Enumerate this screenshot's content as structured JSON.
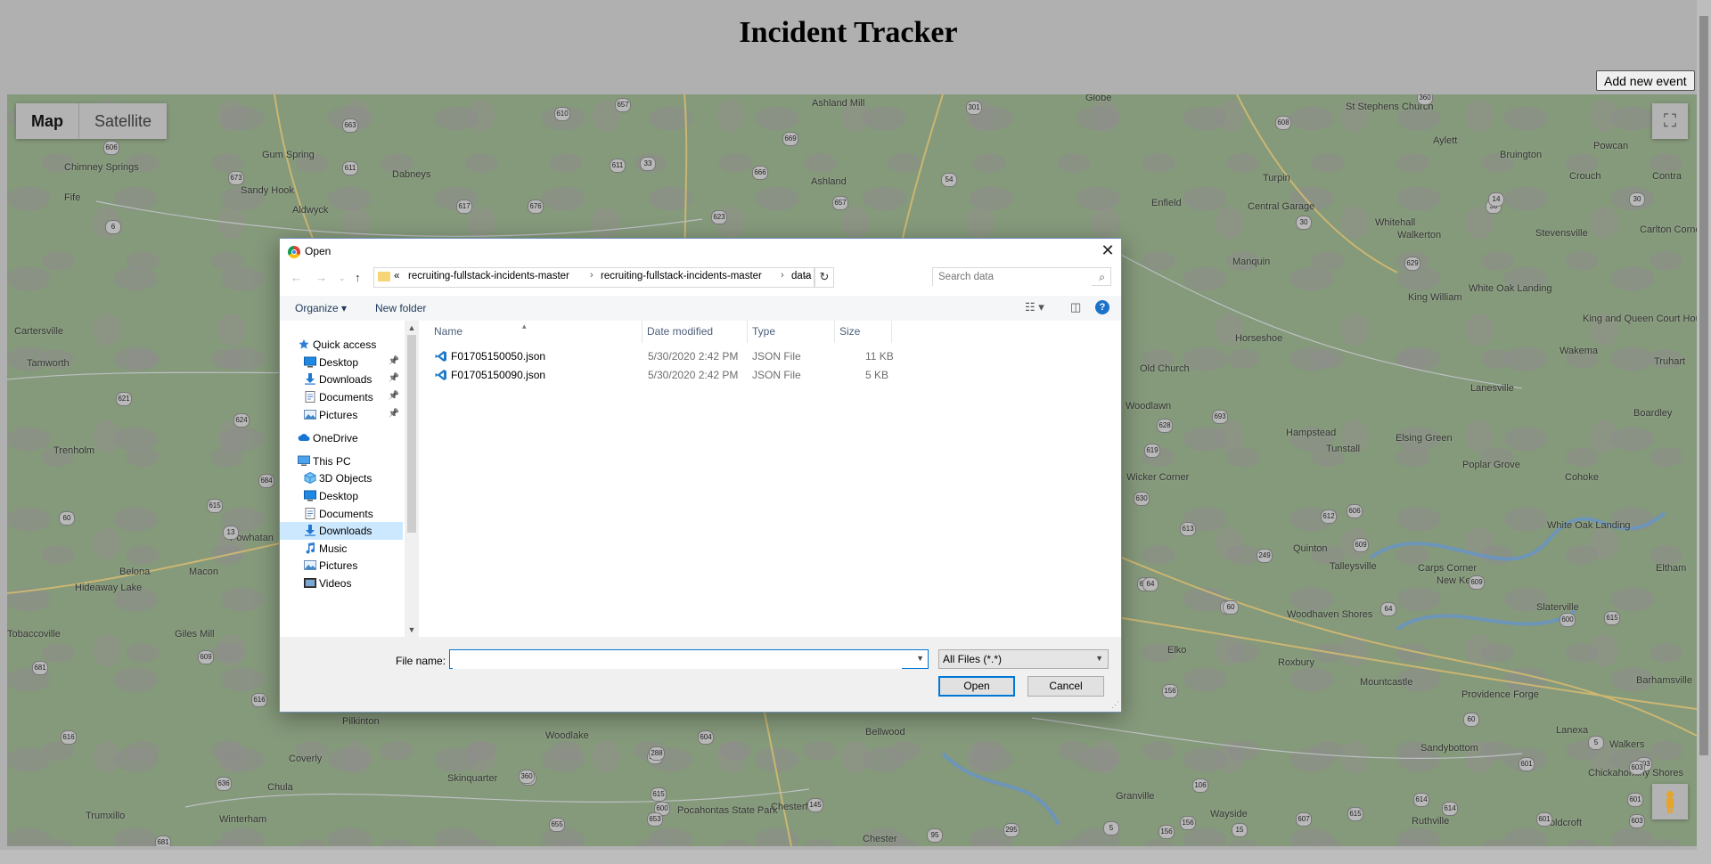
{
  "page": {
    "title": "Incident Tracker",
    "add_button": "Add new event"
  },
  "map": {
    "type_controls": [
      "Map",
      "Satellite"
    ],
    "places": [
      {
        "name": "Ashland Mill"
      },
      {
        "name": "Globe"
      },
      {
        "name": "St Stephens Church"
      },
      {
        "name": "Gum Spring"
      },
      {
        "name": "Chimney Springs"
      },
      {
        "name": "Dabneys"
      },
      {
        "name": "Ashland"
      },
      {
        "name": "Aylett"
      },
      {
        "name": "Powcan"
      },
      {
        "name": "Bruington"
      },
      {
        "name": "Crouch"
      },
      {
        "name": "Contra"
      },
      {
        "name": "Sandy Hook"
      },
      {
        "name": "Fife"
      },
      {
        "name": "Aldwyck"
      },
      {
        "name": "Turpin"
      },
      {
        "name": "Enfield"
      },
      {
        "name": "Central Garage"
      },
      {
        "name": "Whitehall"
      },
      {
        "name": "Walkerton"
      },
      {
        "name": "Stevensville"
      },
      {
        "name": "Carlton Corner"
      },
      {
        "name": "Manquin"
      },
      {
        "name": "King William"
      },
      {
        "name": "White Oak Landing"
      },
      {
        "name": "Cartersville"
      },
      {
        "name": "Horseshoe"
      },
      {
        "name": "King and Queen Court House"
      },
      {
        "name": "Wakema"
      },
      {
        "name": "Truhart"
      },
      {
        "name": "Tamworth"
      },
      {
        "name": "Old Church"
      },
      {
        "name": "Woodlawn"
      },
      {
        "name": "Lanesville"
      },
      {
        "name": "Boardley"
      },
      {
        "name": "Trenholm"
      },
      {
        "name": "Hampstead"
      },
      {
        "name": "Tunstall"
      },
      {
        "name": "Elsing Green"
      },
      {
        "name": "Poplar Grove"
      },
      {
        "name": "Wicker Corner"
      },
      {
        "name": "Cohoke"
      },
      {
        "name": "Powhatan"
      },
      {
        "name": "White Oak Landing"
      },
      {
        "name": "Quinton"
      },
      {
        "name": "Talleysville"
      },
      {
        "name": "Carps Corner"
      },
      {
        "name": "New Kent"
      },
      {
        "name": "Eltham"
      },
      {
        "name": "Belona"
      },
      {
        "name": "Macon"
      },
      {
        "name": "Hideaway Lake"
      },
      {
        "name": "Woodhaven Shores"
      },
      {
        "name": "Slaterville"
      },
      {
        "name": "Giles Mill"
      },
      {
        "name": "Tobaccoville"
      },
      {
        "name": "Elko"
      },
      {
        "name": "Roxbury"
      },
      {
        "name": "Mountcastle"
      },
      {
        "name": "Barhamsville"
      },
      {
        "name": "Providence Forge"
      },
      {
        "name": "Pilkinton"
      },
      {
        "name": "Woodlake"
      },
      {
        "name": "Bellwood"
      },
      {
        "name": "Lanexa"
      },
      {
        "name": "Sandybottom"
      },
      {
        "name": "Walkers"
      },
      {
        "name": "Coverly"
      },
      {
        "name": "Chula"
      },
      {
        "name": "Skinquarter"
      },
      {
        "name": "Chickahominy Shores"
      },
      {
        "name": "Trumxillo"
      },
      {
        "name": "Winterham"
      },
      {
        "name": "Pocahontas State Park"
      },
      {
        "name": "Chesterfield"
      },
      {
        "name": "Granville"
      },
      {
        "name": "Wayside"
      },
      {
        "name": "Ruthville"
      },
      {
        "name": "Holdcroft"
      },
      {
        "name": "Chester"
      }
    ],
    "shields": [
      "663",
      "610",
      "657",
      "301",
      "360",
      "608",
      "606",
      "673",
      "611",
      "33",
      "669",
      "54",
      "611",
      "617",
      "676",
      "623",
      "666",
      "657",
      "6",
      "30",
      "30",
      "14",
      "629",
      "30",
      "624",
      "621",
      "684",
      "615",
      "60",
      "613",
      "693",
      "628",
      "619",
      "612",
      "606",
      "630",
      "60",
      "13",
      "609",
      "249",
      "609",
      "615",
      "600",
      "64",
      "60",
      "64",
      "681",
      "609",
      "616",
      "156",
      "60",
      "600",
      "616",
      "636",
      "360",
      "288",
      "604",
      "600",
      "5",
      "614",
      "603",
      "601",
      "603",
      "601",
      "288",
      "360",
      "615",
      "653",
      "655",
      "145",
      "106",
      "156",
      "607",
      "615",
      "15",
      "614",
      "601",
      "681",
      "603",
      "95",
      "295",
      "5",
      "156"
    ]
  },
  "dialog": {
    "title": "Open",
    "breadcrumb": [
      "«",
      "recruiting-fullstack-incidents-master",
      "recruiting-fullstack-incidents-master",
      "data"
    ],
    "search_placeholder": "Search data",
    "toolbar": {
      "organize": "Organize ▾",
      "new_folder": "New folder"
    },
    "nav": [
      {
        "label": "Quick access",
        "type": "star",
        "indent": 0,
        "pin": false
      },
      {
        "label": "Desktop",
        "type": "desktop",
        "indent": 1,
        "pin": true
      },
      {
        "label": "Downloads",
        "type": "download",
        "indent": 1,
        "pin": true
      },
      {
        "label": "Documents",
        "type": "doc",
        "indent": 1,
        "pin": true
      },
      {
        "label": "Pictures",
        "type": "pic",
        "indent": 1,
        "pin": true
      },
      {
        "label": "OneDrive",
        "type": "cloud",
        "indent": 0,
        "pin": false
      },
      {
        "label": "This PC",
        "type": "pc",
        "indent": 0,
        "pin": false
      },
      {
        "label": "3D Objects",
        "type": "cube",
        "indent": 1,
        "pin": false
      },
      {
        "label": "Desktop",
        "type": "desktop",
        "indent": 1,
        "pin": false
      },
      {
        "label": "Documents",
        "type": "doc",
        "indent": 1,
        "pin": false
      },
      {
        "label": "Downloads",
        "type": "download",
        "indent": 1,
        "pin": false,
        "selected": true
      },
      {
        "label": "Music",
        "type": "music",
        "indent": 1,
        "pin": false
      },
      {
        "label": "Pictures",
        "type": "pic",
        "indent": 1,
        "pin": false
      },
      {
        "label": "Videos",
        "type": "video",
        "indent": 1,
        "pin": false
      }
    ],
    "columns": [
      "Name",
      "Date modified",
      "Type",
      "Size"
    ],
    "files": [
      {
        "name": "F01705150050.json",
        "date": "5/30/2020 2:42 PM",
        "type": "JSON File",
        "size": "11 KB"
      },
      {
        "name": "F01705150090.json",
        "date": "5/30/2020 2:42 PM",
        "type": "JSON File",
        "size": "5 KB"
      }
    ],
    "file_name_label": "File name:",
    "file_name_value": "",
    "filter": "All Files (*.*)",
    "open_button": "Open",
    "cancel_button": "Cancel"
  }
}
